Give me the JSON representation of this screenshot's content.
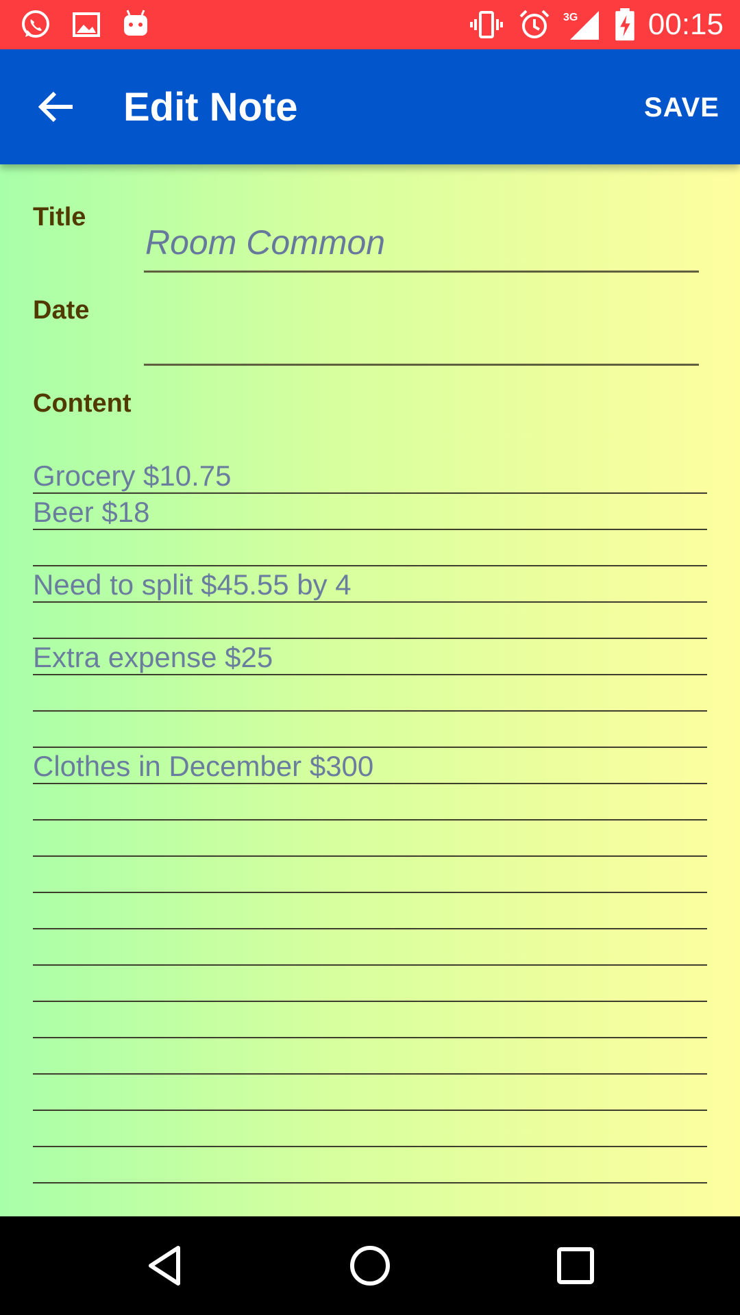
{
  "status_bar": {
    "time": "00:15",
    "network": "3G",
    "icons": [
      "whatsapp-icon",
      "image-icon",
      "android-icon",
      "vibrate-icon",
      "alarm-icon",
      "signal-icon",
      "battery-charging-icon"
    ]
  },
  "app_bar": {
    "title": "Edit Note",
    "save_label": "SAVE",
    "back_icon": "arrow-back-icon",
    "color": "#0255cb"
  },
  "form": {
    "title_label": "Title",
    "title_value": "Room Common",
    "date_label": "Date",
    "date_value": "",
    "content_label": "Content",
    "content_lines": [
      "Grocery $10.75",
      "Beer $18",
      "",
      "Need to split $45.55 by 4",
      "",
      "Extra expense $25",
      "",
      "",
      "Clothes in December $300"
    ]
  },
  "colors": {
    "status_bar": "#fd3c3f",
    "gradient_left": "#a8ffa9",
    "gradient_right": "#fefe9f",
    "label_color": "#513a00",
    "text_color": "#6a7d9e"
  },
  "nav_bar": {
    "icons": [
      "back-triangle-icon",
      "home-circle-icon",
      "recents-square-icon"
    ]
  }
}
